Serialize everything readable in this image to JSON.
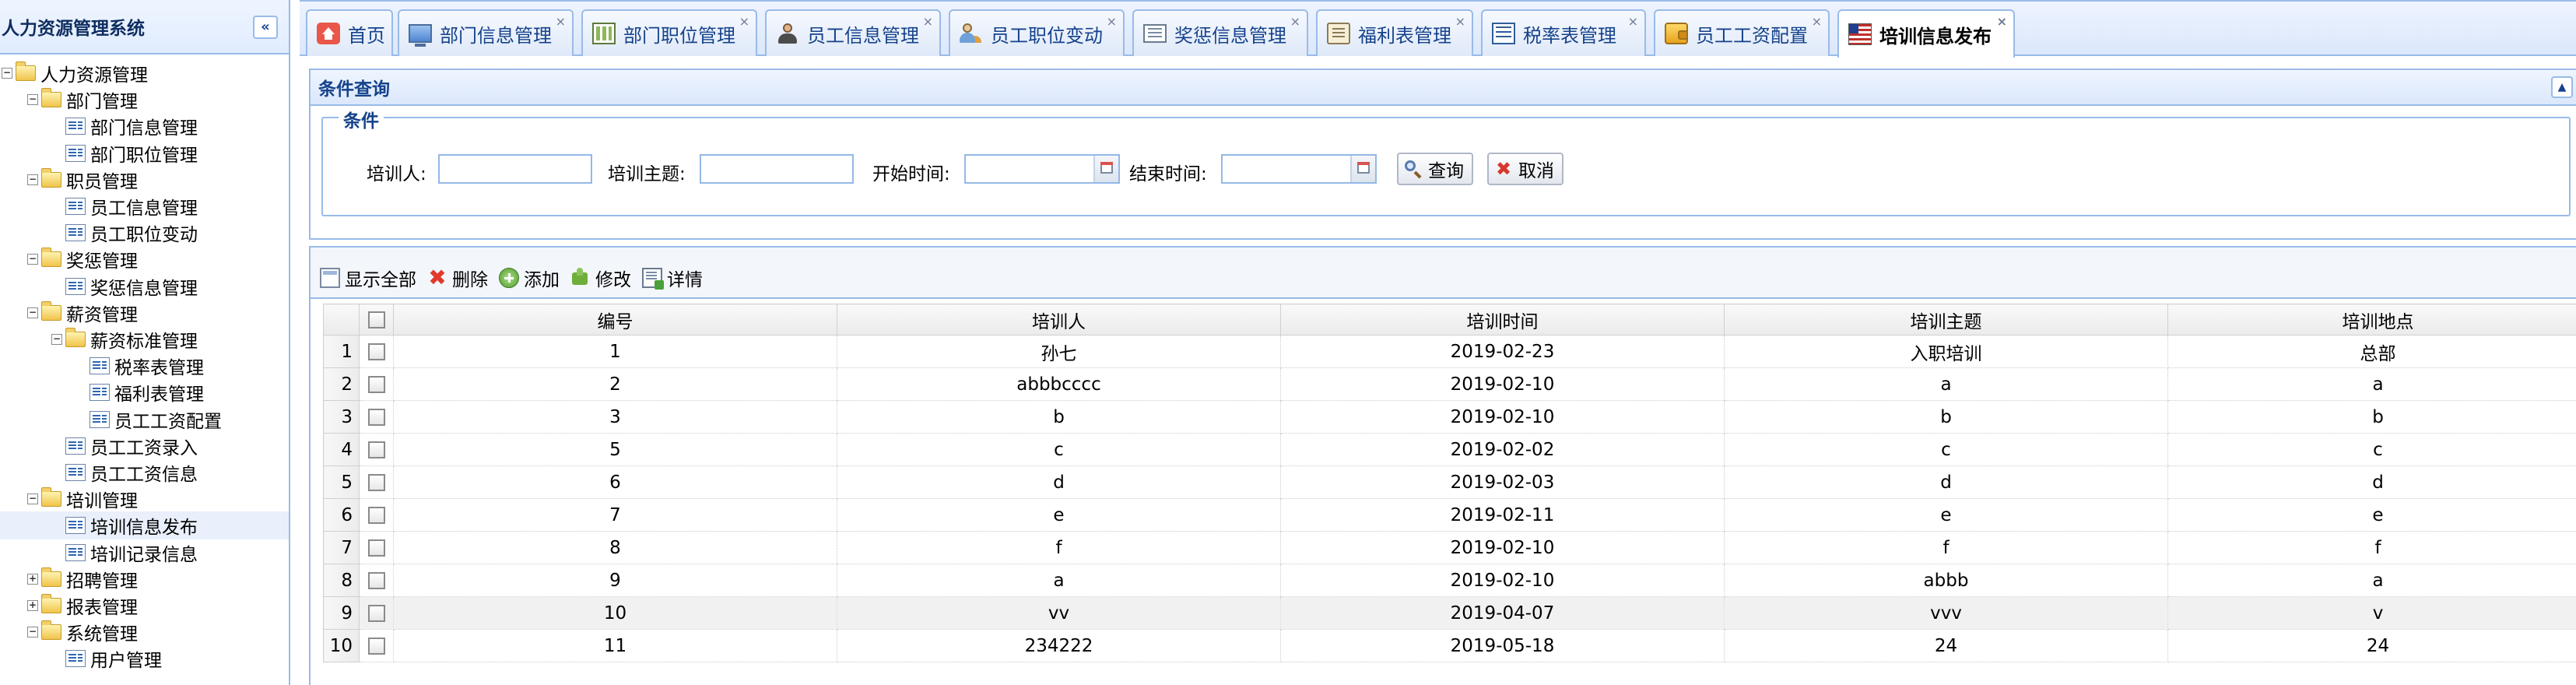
{
  "sidebar": {
    "title": "人力资源管理系统",
    "collapse_glyph": "«",
    "tree": [
      {
        "label": "人力资源管理",
        "level": 0,
        "kind": "folder",
        "state": "-",
        "name": "tree-node-hr-root"
      },
      {
        "label": "部门管理",
        "level": 1,
        "kind": "folder",
        "state": "-",
        "name": "tree-node-department"
      },
      {
        "label": "部门信息管理",
        "level": 2,
        "kind": "leaf",
        "name": "tree-item-department-info"
      },
      {
        "label": "部门职位管理",
        "level": 2,
        "kind": "leaf",
        "name": "tree-item-department-position"
      },
      {
        "label": "职员管理",
        "level": 1,
        "kind": "folder",
        "state": "-",
        "name": "tree-node-staff"
      },
      {
        "label": "员工信息管理",
        "level": 2,
        "kind": "leaf",
        "name": "tree-item-employee-info"
      },
      {
        "label": "员工职位变动",
        "level": 2,
        "kind": "leaf",
        "name": "tree-item-employee-position-change"
      },
      {
        "label": "奖惩管理",
        "level": 1,
        "kind": "folder",
        "state": "-",
        "name": "tree-node-rewards"
      },
      {
        "label": "奖惩信息管理",
        "level": 2,
        "kind": "leaf",
        "name": "tree-item-rewards-info"
      },
      {
        "label": "薪资管理",
        "level": 1,
        "kind": "folder",
        "state": "-",
        "name": "tree-node-salary"
      },
      {
        "label": "薪资标准管理",
        "level": 2,
        "kind": "folder",
        "state": "-",
        "name": "tree-node-salary-standard"
      },
      {
        "label": "税率表管理",
        "level": 3,
        "kind": "leaf",
        "name": "tree-item-tax-rate"
      },
      {
        "label": "福利表管理",
        "level": 3,
        "kind": "leaf",
        "name": "tree-item-welfare"
      },
      {
        "label": "员工工资配置",
        "level": 3,
        "kind": "leaf",
        "name": "tree-item-salary-config"
      },
      {
        "label": "员工工资录入",
        "level": 2,
        "kind": "leaf",
        "name": "tree-item-salary-entry"
      },
      {
        "label": "员工工资信息",
        "level": 2,
        "kind": "leaf",
        "name": "tree-item-salary-info"
      },
      {
        "label": "培训管理",
        "level": 1,
        "kind": "folder",
        "state": "-",
        "name": "tree-node-training"
      },
      {
        "label": "培训信息发布",
        "level": 2,
        "kind": "leaf",
        "selected": true,
        "name": "tree-item-training-publish"
      },
      {
        "label": "培训记录信息",
        "level": 2,
        "kind": "leaf",
        "name": "tree-item-training-records"
      },
      {
        "label": "招聘管理",
        "level": 1,
        "kind": "folder",
        "state": "+",
        "name": "tree-node-recruitment"
      },
      {
        "label": "报表管理",
        "level": 1,
        "kind": "folder",
        "state": "+",
        "name": "tree-node-reports"
      },
      {
        "label": "系统管理",
        "level": 1,
        "kind": "folder",
        "state": "-",
        "name": "tree-node-system"
      },
      {
        "label": "用户管理",
        "level": 2,
        "kind": "leaf",
        "name": "tree-item-user-management"
      }
    ]
  },
  "tabs": [
    {
      "label": "首页",
      "icon": "home-icon",
      "closable": false,
      "name": "tab-home"
    },
    {
      "label": "部门信息管理",
      "icon": "monitor-icon",
      "closable": true,
      "name": "tab-department-info"
    },
    {
      "label": "部门职位管理",
      "icon": "grid-icon",
      "closable": true,
      "name": "tab-department-position"
    },
    {
      "label": "员工信息管理",
      "icon": "user-icon",
      "closable": true,
      "name": "tab-employee-info"
    },
    {
      "label": "员工职位变动",
      "icon": "user-move-icon",
      "closable": true,
      "name": "tab-employee-position-change"
    },
    {
      "label": "奖惩信息管理",
      "icon": "list-icon",
      "closable": true,
      "name": "tab-rewards-info"
    },
    {
      "label": "福利表管理",
      "icon": "scroll-icon",
      "closable": true,
      "name": "tab-welfare"
    },
    {
      "label": "税率表管理",
      "icon": "table-icon",
      "closable": true,
      "name": "tab-tax-rate"
    },
    {
      "label": "员工工资配置",
      "icon": "wallet-icon",
      "closable": true,
      "name": "tab-salary-config"
    },
    {
      "label": "培训信息发布",
      "icon": "flag-icon",
      "closable": true,
      "active": true,
      "name": "tab-training-publish"
    }
  ],
  "tab_close_glyph": "×",
  "query": {
    "panel_title": "条件查询",
    "legend": "条件",
    "trainer_label": "培训人:",
    "trainer_value": "",
    "topic_label": "培训主题:",
    "topic_value": "",
    "start_label": "开始时间:",
    "start_value": "",
    "end_label": "结束时间:",
    "end_value": "",
    "search_button": "查询",
    "cancel_button": "取消",
    "collapse_glyph": "▲"
  },
  "toolbar": {
    "show_all": "显示全部",
    "delete": "删除",
    "add": "添加",
    "edit": "修改",
    "detail": "详情"
  },
  "grid": {
    "columns": [
      "编号",
      "培训人",
      "培训时间",
      "培训主题",
      "培训地点"
    ],
    "highlighted_row": 9,
    "rows": [
      {
        "n": "1",
        "id": "1",
        "trainer": "孙七",
        "date": "2019-02-23",
        "topic": "入职培训",
        "place": "总部"
      },
      {
        "n": "2",
        "id": "2",
        "trainer": "abbbcccc",
        "date": "2019-02-10",
        "topic": "a",
        "place": "a"
      },
      {
        "n": "3",
        "id": "3",
        "trainer": "b",
        "date": "2019-02-10",
        "topic": "b",
        "place": "b"
      },
      {
        "n": "4",
        "id": "5",
        "trainer": "c",
        "date": "2019-02-02",
        "topic": "c",
        "place": "c"
      },
      {
        "n": "5",
        "id": "6",
        "trainer": "d",
        "date": "2019-02-03",
        "topic": "d",
        "place": "d"
      },
      {
        "n": "6",
        "id": "7",
        "trainer": "e",
        "date": "2019-02-11",
        "topic": "e",
        "place": "e"
      },
      {
        "n": "7",
        "id": "8",
        "trainer": "f",
        "date": "2019-02-10",
        "topic": "f",
        "place": "f"
      },
      {
        "n": "8",
        "id": "9",
        "trainer": "a",
        "date": "2019-02-10",
        "topic": "abbb",
        "place": "a"
      },
      {
        "n": "9",
        "id": "10",
        "trainer": "vv",
        "date": "2019-04-07",
        "topic": "vvv",
        "place": "v"
      },
      {
        "n": "10",
        "id": "11",
        "trainer": "234222",
        "date": "2019-05-18",
        "topic": "24",
        "place": "24"
      }
    ]
  }
}
